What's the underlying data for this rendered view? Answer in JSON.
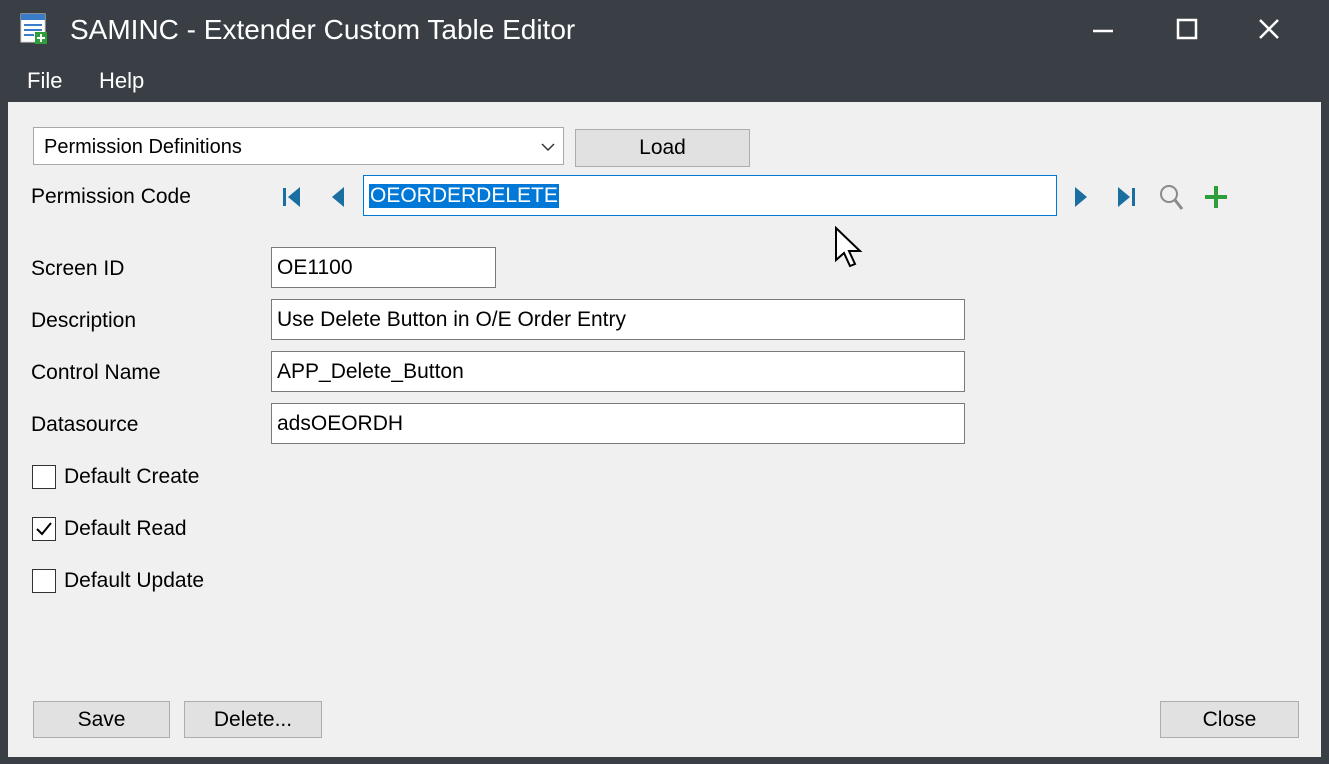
{
  "window": {
    "title": "SAMINC - Extender Custom Table Editor",
    "app_icon": "table-add-icon",
    "controls": [
      "minimize-icon",
      "maximize-icon",
      "close-icon"
    ]
  },
  "menu": {
    "items": [
      "File",
      "Help"
    ]
  },
  "table_selector": {
    "value": "Permission Definitions",
    "load_label": "Load"
  },
  "record": {
    "code_label": "Permission Code",
    "code_value": "OEORDERDELETE",
    "nav_icons": [
      "first-record-icon",
      "previous-record-icon",
      "next-record-icon",
      "last-record-icon",
      "search-icon",
      "add-icon"
    ]
  },
  "fields": {
    "screen_id": {
      "label": "Screen ID",
      "value": "OE1100"
    },
    "description": {
      "label": "Description",
      "value": "Use Delete Button in O/E Order Entry"
    },
    "control_name": {
      "label": "Control Name",
      "value": "APP_Delete_Button"
    },
    "datasource": {
      "label": "Datasource",
      "value": "adsOEORDH"
    }
  },
  "checkboxes": {
    "create": {
      "label": "Default Create",
      "checked": false
    },
    "read": {
      "label": "Default Read",
      "checked": true
    },
    "update": {
      "label": "Default Update",
      "checked": false
    }
  },
  "buttons": {
    "save": "Save",
    "delete": "Delete...",
    "close": "Close"
  },
  "colors": {
    "chrome": "#3a3f45",
    "client": "#f0f0f0",
    "nav_accent": "#1a6fa0",
    "add_accent": "#2e9e3a",
    "selection": "#0078d7"
  }
}
